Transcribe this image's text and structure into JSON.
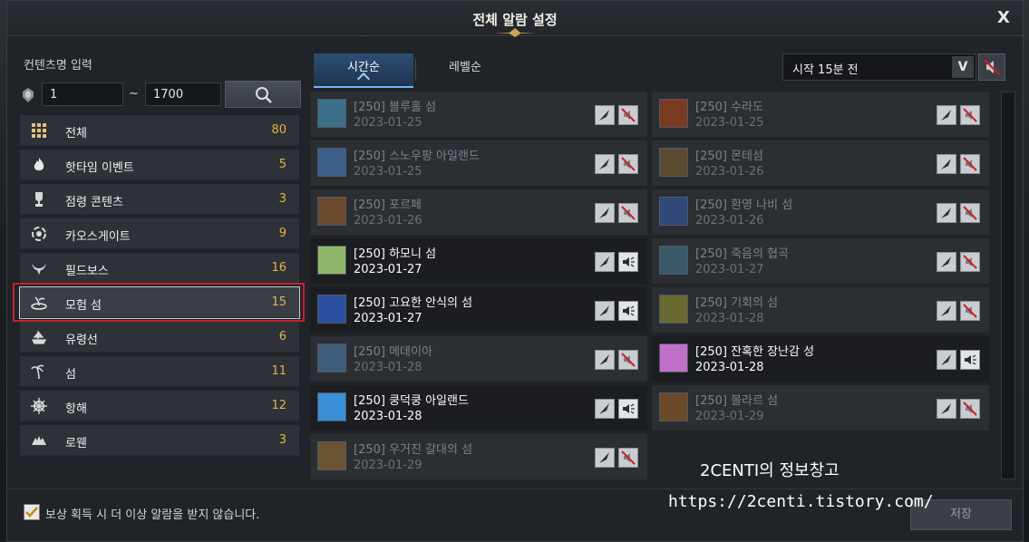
{
  "window": {
    "title": "전체 알람 설정",
    "close": "X"
  },
  "filter": {
    "label": "컨텐츠명 입력",
    "from": "1",
    "tilde": "~",
    "to": "1700"
  },
  "categories": [
    {
      "label": "전체",
      "count": "80",
      "icon": "grid-icon"
    },
    {
      "label": "핫타임 이벤트",
      "count": "5",
      "icon": "fire-icon"
    },
    {
      "label": "점령 콘텐츠",
      "count": "3",
      "icon": "trophy-icon"
    },
    {
      "label": "카오스게이트",
      "count": "9",
      "icon": "vortex-icon"
    },
    {
      "label": "필드보스",
      "count": "16",
      "icon": "horns-icon"
    },
    {
      "label": "모험 섬",
      "count": "15",
      "icon": "island-icon",
      "selected": true
    },
    {
      "label": "유령선",
      "count": "6",
      "icon": "ship-icon"
    },
    {
      "label": "섬",
      "count": "11",
      "icon": "palm-icon"
    },
    {
      "label": "항해",
      "count": "12",
      "icon": "helm-icon"
    },
    {
      "label": "로웬",
      "count": "3",
      "icon": "wolf-icon"
    }
  ],
  "tabs": {
    "time": "시간순",
    "level": "레벨순"
  },
  "time_select": {
    "value": "시작 15분 전"
  },
  "left_column": [
    {
      "name": "[250] 블루홀 섬",
      "date": "2023-01-25",
      "active": false,
      "thumb": "#3b6f8a"
    },
    {
      "name": "[250] 스노우팡 아일랜드",
      "date": "2023-01-25",
      "active": false,
      "thumb": "#3d5f8c"
    },
    {
      "name": "[250] 포르페",
      "date": "2023-01-26",
      "active": false,
      "thumb": "#6b4a2e"
    },
    {
      "name": "[250] 하모니 섬",
      "date": "2023-01-27",
      "active": true,
      "thumb": "#8fb86a"
    },
    {
      "name": "[250] 고요한 안식의 섬",
      "date": "2023-01-27",
      "active": true,
      "thumb": "#2a4fa0"
    },
    {
      "name": "[250] 메데이아",
      "date": "2023-01-28",
      "active": false,
      "thumb": "#3f5c7a"
    },
    {
      "name": "[250] 쿵덕쿵 아일랜드",
      "date": "2023-01-28",
      "active": true,
      "thumb": "#3a8fd6"
    },
    {
      "name": "[250] 우거진 갈대의 섬",
      "date": "2023-01-29",
      "active": false,
      "thumb": "#6a5433"
    }
  ],
  "right_column": [
    {
      "name": "[250] 수라도",
      "date": "2023-01-25",
      "active": false,
      "thumb": "#7a3a22"
    },
    {
      "name": "[250] 몬테섬",
      "date": "2023-01-26",
      "active": false,
      "thumb": "#5a4a30"
    },
    {
      "name": "[250] 환영 나비 섬",
      "date": "2023-01-26",
      "active": false,
      "thumb": "#2f4a7a"
    },
    {
      "name": "[250] 죽음의 협곡",
      "date": "2023-01-27",
      "active": false,
      "thumb": "#3a5a6a"
    },
    {
      "name": "[250] 기회의 섬",
      "date": "2023-01-28",
      "active": false,
      "thumb": "#6a6a30"
    },
    {
      "name": "[250] 잔혹한 장난감 성",
      "date": "2023-01-28",
      "active": true,
      "thumb": "#c070c8"
    },
    {
      "name": "[250] 볼라르 섬",
      "date": "2023-01-29",
      "active": false,
      "thumb": "#6a4a2a"
    }
  ],
  "bottom": {
    "checkbox_label": "보상 획득 시 더 이상 알람을 받지 않습니다.",
    "save": "저장"
  },
  "watermark": {
    "line1": "2CENTI의 정보창고",
    "line2": "https://2centi.tistory.com/"
  },
  "colors": {
    "accent_count": "#e6b34a",
    "selection_frame": "#c81f2b",
    "tab_active": "#2d4e72"
  }
}
